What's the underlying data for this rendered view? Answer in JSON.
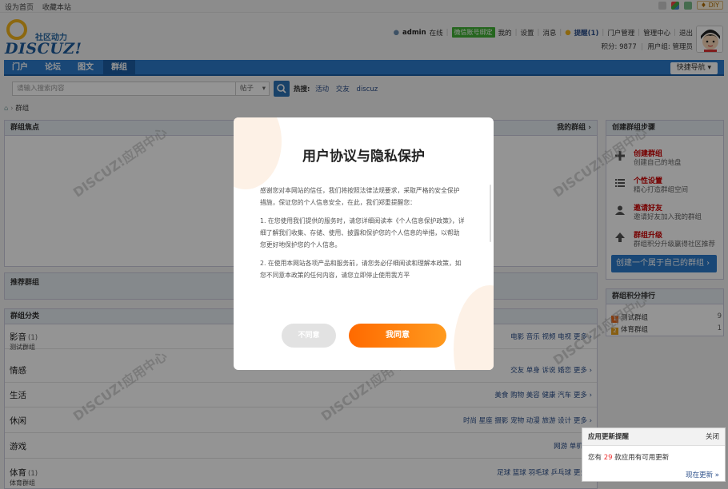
{
  "topbar": {
    "set_home": "设为首页",
    "bookmark": "收藏本站",
    "diy": "DIY"
  },
  "logo": {
    "slogan": "社区动力",
    "brand": "DISCUZ!"
  },
  "user": {
    "name": "admin",
    "online": "在线",
    "wechat": "微信账号绑定",
    "my": "我的",
    "settings": "设置",
    "messages": "消息",
    "remind": "提醒(1)",
    "portal_manage": "门户管理",
    "admin_center": "管理中心",
    "logout": "退出",
    "points": "积分: 9877",
    "user_group": "用户组: 管理员"
  },
  "nav": {
    "items": [
      "门户",
      "论坛",
      "图文",
      "群组"
    ],
    "active_index": 3,
    "quick_nav": "快捷导航"
  },
  "search": {
    "placeholder": "请输入搜索内容",
    "type": "帖子",
    "hot_label": "热搜:",
    "hot_items": [
      "活动",
      "交友",
      "discuz"
    ]
  },
  "breadcrumb": {
    "current": "群组"
  },
  "focus_panel": {
    "title": "群组焦点",
    "my_groups": "我的群组"
  },
  "recommend_panel": {
    "title": "推荐群组"
  },
  "category_panel": {
    "title": "群组分类",
    "rows": [
      {
        "name": "影音",
        "count": "(1)",
        "sub": "测试群组",
        "tags": "电影 音乐 视频 电视 更多"
      },
      {
        "name": "情感",
        "count": "",
        "sub": "",
        "tags": "交友 单身 诉说 婚恋 更多"
      },
      {
        "name": "生活",
        "count": "",
        "sub": "",
        "tags": "美食 购物 美容 健康 汽车 更多"
      },
      {
        "name": "休闲",
        "count": "",
        "sub": "",
        "tags": "时尚 星座 摄影 宠物 动漫 旅游 设计 更多"
      },
      {
        "name": "游戏",
        "count": "",
        "sub": "",
        "tags": "网游 单机 更"
      },
      {
        "name": "体育",
        "count": "(1)",
        "sub": "体育群组",
        "tags": "足球 篮球 羽毛球 乒乓球 更多"
      }
    ]
  },
  "steps_panel": {
    "title": "创建群组步骤",
    "steps": [
      {
        "title": "创建群组",
        "desc": "创建自己的地盘",
        "icon": "plus-icon"
      },
      {
        "title": "个性设置",
        "desc": "精心打造群组空间",
        "icon": "list-icon"
      },
      {
        "title": "邀请好友",
        "desc": "邀请好友加入我的群组",
        "icon": "user-icon"
      },
      {
        "title": "群组升级",
        "desc": "群组积分升级赢得社区推荐",
        "icon": "arrow-up-icon"
      }
    ],
    "cta": "创建一个属于自己的群组"
  },
  "rank_panel": {
    "title": "群组积分排行",
    "items": [
      {
        "no": "1",
        "name": "测试群组",
        "count": "9"
      },
      {
        "no": "2",
        "name": "体育群组",
        "count": "1"
      }
    ]
  },
  "modal": {
    "title": "用户协议与隐私保护",
    "paragraphs": [
      "感谢您对本网站的信任，我们将按照法律法规要求，采取严格的安全保护措施，保证您的个人信息安全，在此，我们郑重提醒您：",
      "1. 在您使用我们提供的服务时，请您详细阅读本《个人信息保护政策》，详细了解我们收集、存储、使用、披露和保护您的个人信息的举措，以帮助您更好地保护您的个人信息。",
      "2. 在使用本网站各项产品和服务前，请您务必仔细阅读和理解本政策，如您不同意本政策的任何内容，请您立即停止使用我方平"
    ],
    "disagree": "不同意",
    "agree": "我同意"
  },
  "notify": {
    "title": "应用更新提醒",
    "close": "关闭",
    "body_prefix": "您有",
    "count": "29",
    "body_suffix": "款应用有可用更新",
    "link": "现在更新"
  },
  "colors": {
    "nav_blue": "#2b7acb",
    "accent_orange": "#ff7a00",
    "link_blue": "#2b4f8a",
    "step_red": "#cc0000"
  }
}
